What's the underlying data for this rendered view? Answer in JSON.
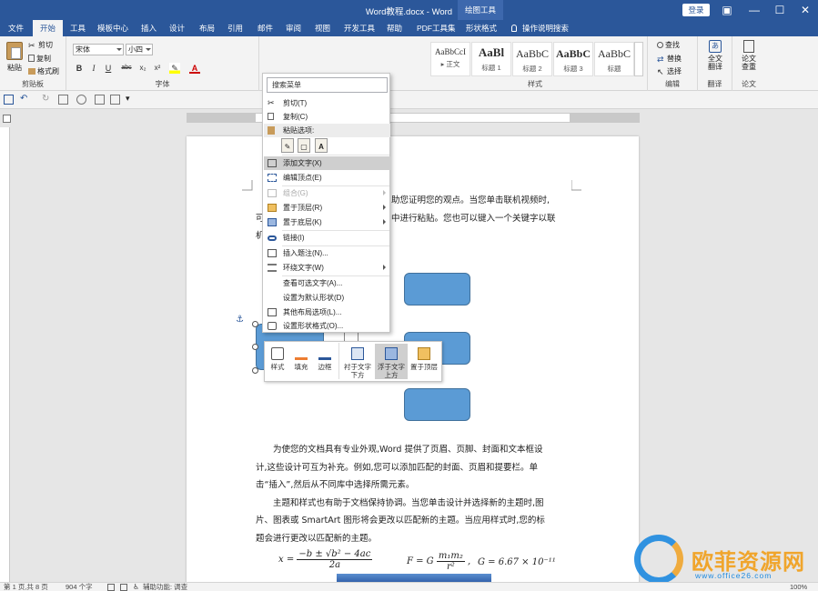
{
  "titlebar": {
    "title": "Word教程.docx  -  Word",
    "context_tool": "绘图工具",
    "login": "登录"
  },
  "tabs": [
    {
      "label": "文件"
    },
    {
      "label": "开始"
    },
    {
      "label": "工具"
    },
    {
      "label": "模板中心"
    },
    {
      "label": "插入"
    },
    {
      "label": "设计"
    },
    {
      "label": "布局"
    },
    {
      "label": "引用"
    },
    {
      "label": "邮件"
    },
    {
      "label": "审阅"
    },
    {
      "label": "视图"
    },
    {
      "label": "开发工具"
    },
    {
      "label": "帮助"
    },
    {
      "label": "PDF工具集"
    },
    {
      "label": "形状格式"
    },
    {
      "label": "操作说明搜索"
    }
  ],
  "ribbon": {
    "clipboard": {
      "paste": "粘贴",
      "cut": "剪切",
      "copy": "复制",
      "format_painter": "格式刷",
      "label": "剪贴板"
    },
    "font": {
      "family": "宋体",
      "size": "小四",
      "label": "字体",
      "bold": "B",
      "italic": "I",
      "underline": "U",
      "strike": "abc",
      "sub": "x₂",
      "sup": "x²",
      "color": "A"
    },
    "styles": {
      "label": "样式",
      "items": [
        {
          "sample": "AaBbCcI",
          "name": "▸ 正文"
        },
        {
          "sample": "AaBl",
          "name": "标题 1"
        },
        {
          "sample": "AaBbC",
          "name": "标题 2"
        },
        {
          "sample": "AaBbC",
          "name": "标题 3"
        },
        {
          "sample": "AaBbC",
          "name": "标题"
        }
      ]
    },
    "editing": {
      "find": "查找",
      "replace": "替换",
      "select": "选择",
      "label": "编辑"
    },
    "translate": {
      "line1": "全文",
      "line2": "翻译",
      "label": "翻译"
    },
    "paper": {
      "line1": "论文",
      "line2": "查重",
      "label": "论文"
    }
  },
  "context_menu": {
    "search_placeholder": "搜索菜单",
    "items": [
      {
        "label": "剪切(T)",
        "disabled": false
      },
      {
        "label": "复制(C)",
        "disabled": false
      },
      {
        "label": "粘贴选项:",
        "disabled": false
      },
      {
        "label": "添加文字(X)",
        "disabled": false
      },
      {
        "label": "编辑顶点(E)",
        "disabled": false
      },
      {
        "label": "组合(G)",
        "disabled": true
      },
      {
        "label": "置于顶层(R)",
        "disabled": false
      },
      {
        "label": "置于底层(K)",
        "disabled": false
      },
      {
        "label": "链接(I)",
        "disabled": false
      },
      {
        "label": "插入题注(N)...",
        "disabled": false
      },
      {
        "label": "环绕文字(W)",
        "disabled": false
      },
      {
        "label": "查看可选文字(A)...",
        "disabled": false
      },
      {
        "label": "设置为默认形状(D)",
        "disabled": false
      },
      {
        "label": "其他布局选项(L)...",
        "disabled": false
      },
      {
        "label": "设置形状格式(O)...",
        "disabled": false
      }
    ]
  },
  "mini_toolbar": {
    "style": "样式",
    "fill": "填充",
    "outline": "边框",
    "behind_l1": "衬于文字",
    "behind_l2": "下方",
    "front_l1": "浮于文字",
    "front_l2": "上方",
    "bring_front": "置于顶层"
  },
  "document": {
    "line1_right": "助您证明您的观点。当您单击联机视频时,",
    "line2_left": "可",
    "line2_right": "中进行粘贴。您也可以键入一个关键字以联",
    "line3_left": "机",
    "p2_l1": "为使您的文档具有专业外观,Word 提供了页眉、页脚、封面和文本框设",
    "p2_l2": "计,这些设计可互为补充。例如,您可以添加匹配的封面、页眉和提要栏。单",
    "p2_l3": "击“插入”,然后从不同库中选择所需元素。",
    "p3_l1": "主题和样式也有助于文档保持协调。当您单击设计并选择新的主题时,图",
    "p3_l2": "片、图表或 SmartArt 图形将会更改以匹配新的主题。当应用样式时,您的标",
    "p3_l3": "题会进行更改以匹配新的主题。",
    "formula1_lhs": "x =",
    "formula1_num": "−b ± √b² − 4ac",
    "formula1_den": "2a",
    "formula2_lhs": "F = G",
    "formula2_num": "m₁m₂",
    "formula2_den": "r²",
    "formula2_tail": ",",
    "formula3": "G = 6.67 × 10⁻¹¹"
  },
  "statusbar": {
    "page": "第 1 页,共 8 页",
    "words": "904 个字",
    "accessibility": "辅助功能: 调查",
    "zoom": "100%"
  },
  "watermark": {
    "text": "欧菲资源网",
    "url": "www.office26.com"
  },
  "colors": {
    "accent": "#2b579a",
    "shape_fill": "#5b9bd5",
    "shape_border": "#41719c"
  }
}
